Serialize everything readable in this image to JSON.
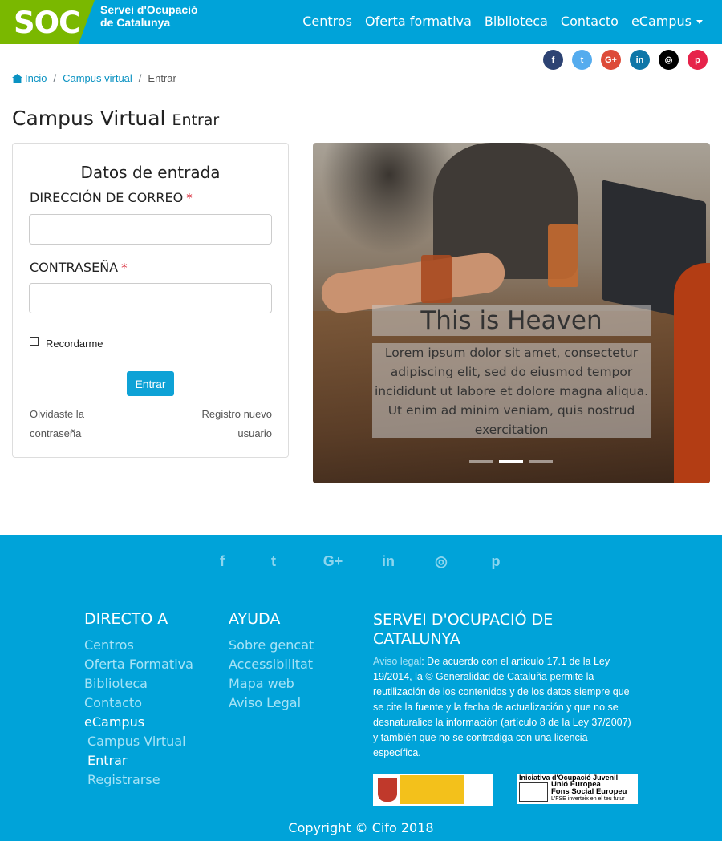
{
  "header": {
    "logo_text": "SOC",
    "org_name_line1": "Servei d'Ocupació",
    "org_name_line2": "de Catalunya",
    "nav": [
      "Centros",
      "Oferta formativa",
      "Biblioteca",
      "Contacto",
      "eCampus"
    ]
  },
  "social": {
    "icons": [
      "facebook-icon",
      "twitter-icon",
      "google-plus-icon",
      "linkedin-icon",
      "instagram-icon",
      "pinterest-icon"
    ],
    "colors": [
      "#2d4373",
      "#55acee",
      "#dd4b39",
      "#0e76a8",
      "#000000",
      "#e6234a"
    ],
    "glyphs": [
      "f",
      "t",
      "G+",
      "in",
      "◎",
      "p"
    ]
  },
  "breadcrumb": [
    "Incio",
    "Campus virtual",
    "Entrar"
  ],
  "page_title": "Campus Virtual",
  "page_subtitle": "Entrar",
  "login": {
    "title": "Datos de entrada",
    "email_label": "DIRECCIÓN DE CORREO",
    "password_label": "CONTRASEÑA",
    "required_mark": "*",
    "remember_label": "Recordarme",
    "submit_label": "Entrar",
    "forgot_label": "Olvidaste la contraseña",
    "register_label": "Registro nuevo usuario"
  },
  "carousel": {
    "title": "This is Heaven",
    "text": "Lorem ipsum dolor sit amet, consectetur adipiscing elit, sed do eiusmod tempor incididunt ut labore et dolore magna aliqua. Ut enim ad minim veniam, quis nostrud exercitation",
    "active_slide": 2,
    "slide_count": 3
  },
  "footer": {
    "col1_title": "DIRECTO A",
    "col1_items": [
      "Centros",
      "Oferta Formativa",
      "Biblioteca",
      "Contacto",
      "eCampus",
      "Campus Virtual",
      "Entrar",
      "Registrarse"
    ],
    "col2_title": "AYUDA",
    "col2_items": [
      "Sobre gencat",
      "Accessibilitat",
      "Mapa web",
      "Aviso Legal"
    ],
    "col3_title": "SERVEI D'OCUPACIÓ DE CATALUNYA",
    "legal_link": "Aviso legal",
    "legal_text": ": De acuerdo con el artículo 17.1 de la Ley 19/2014, la © Generalidad de Cataluña permite la reutilización de los contenidos y de los datos siempre que se cite la fuente y la fecha de actualización y que no se desnaturalice la información (artículo 8 de la Ley 37/2007) y también que no se contradiga con una licencia específica.",
    "eu_logo_line0": "Iniciativa d'Ocupació Juvenil",
    "eu_logo_line1": "Unió Europea",
    "eu_logo_line2": "Fons Social Europeu",
    "eu_logo_line3": "L'FSE inverteix en el teu futur",
    "copyright": "Copyright © Cifo 2018"
  }
}
